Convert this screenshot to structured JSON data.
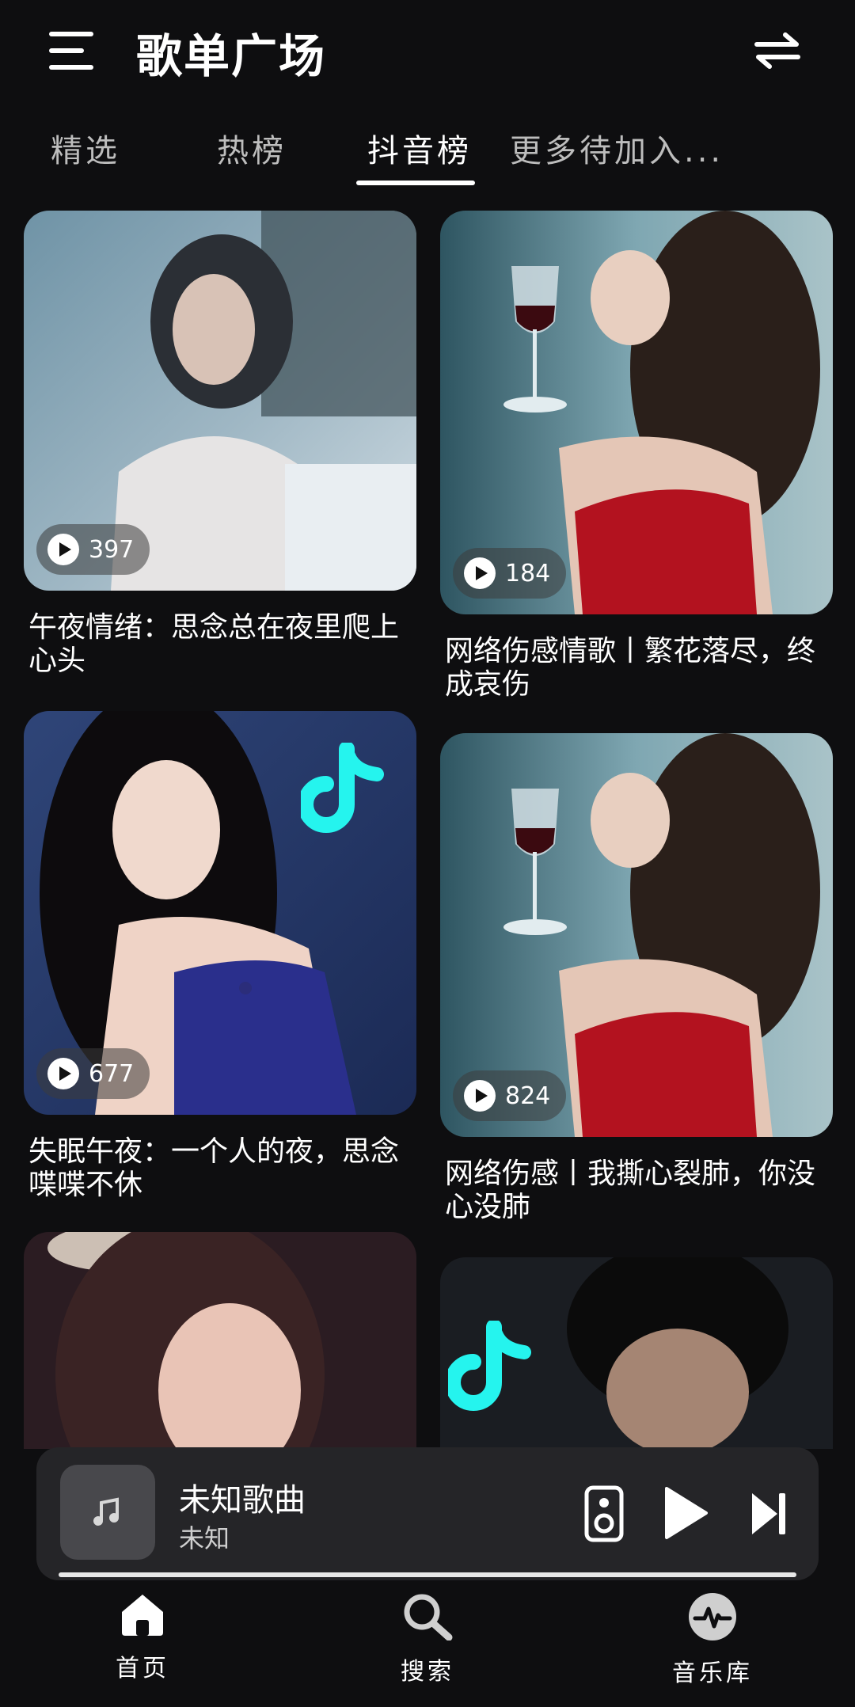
{
  "header": {
    "title": "歌单广场"
  },
  "tabs": [
    {
      "label": "精选"
    },
    {
      "label": "热榜"
    },
    {
      "label": "抖音榜",
      "active": true
    },
    {
      "label": "更多待加入..."
    }
  ],
  "playlists": [
    {
      "title": "午夜情绪：思念总在夜里爬上心头",
      "play_count": "397"
    },
    {
      "title": "网络伤感情歌丨繁花落尽，终成哀伤",
      "play_count": "184"
    },
    {
      "title": "失眠午夜：一个人的夜，思念喋喋不休",
      "play_count": "677"
    },
    {
      "title": "网络伤感丨我撕心裂肺，你没心没肺",
      "play_count": "824"
    },
    {
      "title": "",
      "play_count": ""
    },
    {
      "title": "",
      "play_count": ""
    }
  ],
  "player": {
    "song_title": "未知歌曲",
    "artist": "未知",
    "progress": 1.0
  },
  "bottom_nav": [
    {
      "label": "首页",
      "icon": "home-icon"
    },
    {
      "label": "搜索",
      "icon": "search-icon"
    },
    {
      "label": "音乐库",
      "icon": "music-library-icon"
    }
  ],
  "colors": {
    "background": "#0e0e10",
    "player_bg": "#252528",
    "tiktok_cyan": "#25f4ee"
  }
}
